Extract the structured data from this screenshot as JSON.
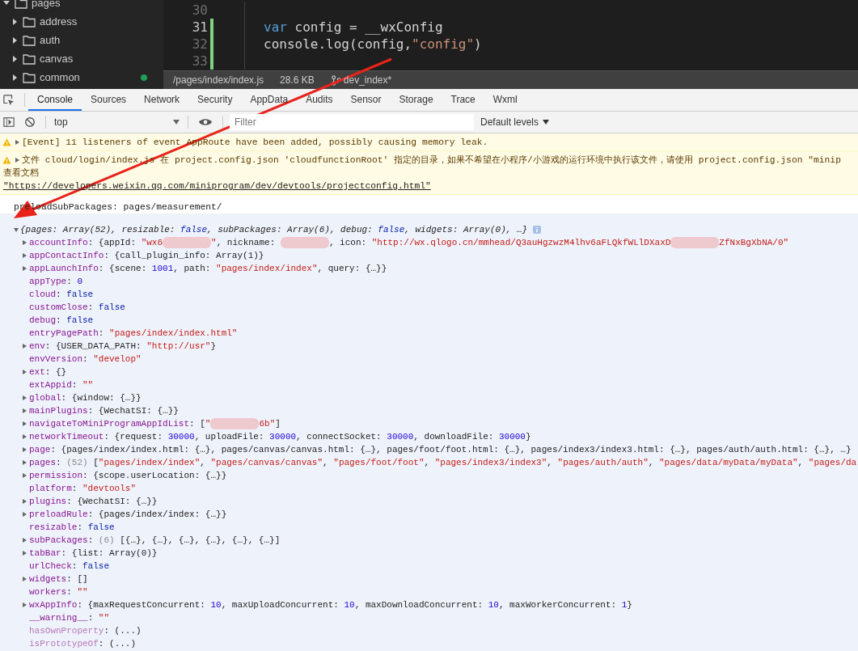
{
  "file_tree": {
    "root": {
      "label": "pages",
      "expanded": true
    },
    "items": [
      {
        "label": "address",
        "expanded": false,
        "modified": false
      },
      {
        "label": "auth",
        "expanded": false,
        "modified": false
      },
      {
        "label": "canvas",
        "expanded": false,
        "modified": false
      },
      {
        "label": "common",
        "expanded": false,
        "modified": true
      }
    ]
  },
  "editor": {
    "lines": [
      {
        "number": "30",
        "current": false,
        "changed": false
      },
      {
        "number": "31",
        "current": true,
        "changed": true,
        "code": [
          {
            "kind": "keyword",
            "text": "var"
          },
          {
            "kind": "plain",
            "text": " config = __wxConfig"
          }
        ]
      },
      {
        "number": "32",
        "current": false,
        "changed": true,
        "code": [
          {
            "kind": "plain",
            "text": "console.log(config,"
          },
          {
            "kind": "string",
            "text": "\"config\""
          },
          {
            "kind": "plain",
            "text": ")"
          }
        ]
      },
      {
        "number": "33",
        "current": false,
        "changed": true
      }
    ]
  },
  "status_bar": {
    "path": "/pages/index/index.js",
    "size": "28.6 KB",
    "branch": "dev_index*"
  },
  "tabs": [
    {
      "label": "Console",
      "selected": true
    },
    {
      "label": "Sources",
      "selected": false
    },
    {
      "label": "Network",
      "selected": false
    },
    {
      "label": "Security",
      "selected": false
    },
    {
      "label": "AppData",
      "selected": false
    },
    {
      "label": "Audits",
      "selected": false
    },
    {
      "label": "Sensor",
      "selected": false
    },
    {
      "label": "Storage",
      "selected": false
    },
    {
      "label": "Trace",
      "selected": false
    },
    {
      "label": "Wxml",
      "selected": false
    }
  ],
  "toolbar": {
    "context": "top",
    "filter": {
      "placeholder": "Filter"
    },
    "levels": "Default levels"
  },
  "messages": [
    {
      "kind": "warning",
      "expanded": false,
      "text": "[Event] 11 listeners of event AppRoute have been added, possibly causing memory leak."
    },
    {
      "kind": "warning",
      "expanded": false,
      "text": "文件 cloud/login/index.js 在 project.config.json 'cloudfunctionRoot' 指定的目录，如果不希望在小程序/小游戏的运行环境中执行该文件，请使用 project.config.json \"minip",
      "text2": "查看文档",
      "link": "\"https://developers.weixin.qq.com/miniprogram/dev/devtools/projectconfig.html\""
    },
    {
      "kind": "log",
      "text": "preloadSubPackages: pages/measurement/"
    }
  ],
  "object": {
    "expanded": true,
    "summary": [
      {
        "kind": "plain",
        "text": "{pages: Array(52), resizable: "
      },
      {
        "kind": "keyword",
        "text": "false"
      },
      {
        "kind": "plain",
        "text": ", subPackages: Array(6), debug: "
      },
      {
        "kind": "keyword",
        "text": "false"
      },
      {
        "kind": "plain",
        "text": ", widgets: Array(0), …}"
      }
    ],
    "properties": [
      {
        "key": "accountInfo",
        "expanded": false,
        "value": [
          {
            "kind": "plain",
            "text": ": {appId: "
          },
          {
            "kind": "string",
            "text": "\"wx6"
          },
          {
            "kind": "redacted"
          },
          {
            "kind": "string",
            "text": "\""
          },
          {
            "kind": "plain",
            "text": ", nickname: "
          },
          {
            "kind": "redacted"
          },
          {
            "kind": "plain",
            "text": ", icon: "
          },
          {
            "kind": "string",
            "text": "\"http://wx.qlogo.cn/mmhead/Q3auHgzwzM4lhv6aFLQkfWLlDXaxD"
          },
          {
            "kind": "redacted"
          },
          {
            "kind": "string",
            "text": "ZfNxBgXbNA/0\""
          }
        ]
      },
      {
        "key": "appContactInfo",
        "expanded": false,
        "value": [
          {
            "kind": "plain",
            "text": ": {call_plugin_info: Array(1)}"
          }
        ]
      },
      {
        "key": "appLaunchInfo",
        "expanded": false,
        "value": [
          {
            "kind": "plain",
            "text": ": {scene: "
          },
          {
            "kind": "number",
            "text": "1001"
          },
          {
            "kind": "plain",
            "text": ", path: "
          },
          {
            "kind": "string",
            "text": "\"pages/index/index\""
          },
          {
            "kind": "plain",
            "text": ", query: {…}}"
          }
        ]
      },
      {
        "key": "appType",
        "value": [
          {
            "kind": "plain",
            "text": ": "
          },
          {
            "kind": "number",
            "text": "0"
          }
        ]
      },
      {
        "key": "cloud",
        "value": [
          {
            "kind": "plain",
            "text": ": "
          },
          {
            "kind": "keyword",
            "text": "false"
          }
        ]
      },
      {
        "key": "customClose",
        "value": [
          {
            "kind": "plain",
            "text": ": "
          },
          {
            "kind": "keyword",
            "text": "false"
          }
        ]
      },
      {
        "key": "debug",
        "value": [
          {
            "kind": "plain",
            "text": ": "
          },
          {
            "kind": "keyword",
            "text": "false"
          }
        ]
      },
      {
        "key": "entryPagePath",
        "value": [
          {
            "kind": "plain",
            "text": ": "
          },
          {
            "kind": "string",
            "text": "\"pages/index/index.html\""
          }
        ]
      },
      {
        "key": "env",
        "expanded": false,
        "value": [
          {
            "kind": "plain",
            "text": ": {USER_DATA_PATH: "
          },
          {
            "kind": "string",
            "text": "\"http://usr\""
          },
          {
            "kind": "plain",
            "text": "}"
          }
        ]
      },
      {
        "key": "envVersion",
        "value": [
          {
            "kind": "plain",
            "text": ": "
          },
          {
            "kind": "string",
            "text": "\"develop\""
          }
        ]
      },
      {
        "key": "ext",
        "expanded": false,
        "value": [
          {
            "kind": "plain",
            "text": ": {}"
          }
        ]
      },
      {
        "key": "extAppid",
        "value": [
          {
            "kind": "plain",
            "text": ": "
          },
          {
            "kind": "string",
            "text": "\"\""
          }
        ]
      },
      {
        "key": "global",
        "expanded": false,
        "value": [
          {
            "kind": "plain",
            "text": ": {window: {…}}"
          }
        ]
      },
      {
        "key": "mainPlugins",
        "expanded": false,
        "value": [
          {
            "kind": "plain",
            "text": ": {WechatSI: {…}}"
          }
        ]
      },
      {
        "key": "navigateToMiniProgramAppIdList",
        "expanded": false,
        "value": [
          {
            "kind": "plain",
            "text": ": ["
          },
          {
            "kind": "string",
            "text": "\""
          },
          {
            "kind": "redacted"
          },
          {
            "kind": "string",
            "text": "6b\""
          },
          {
            "kind": "plain",
            "text": "]"
          }
        ]
      },
      {
        "key": "networkTimeout",
        "expanded": false,
        "value": [
          {
            "kind": "plain",
            "text": ": {request: "
          },
          {
            "kind": "number",
            "text": "30000"
          },
          {
            "kind": "plain",
            "text": ", uploadFile: "
          },
          {
            "kind": "number",
            "text": "30000"
          },
          {
            "kind": "plain",
            "text": ", connectSocket: "
          },
          {
            "kind": "number",
            "text": "30000"
          },
          {
            "kind": "plain",
            "text": ", downloadFile: "
          },
          {
            "kind": "number",
            "text": "30000"
          },
          {
            "kind": "plain",
            "text": "}"
          }
        ]
      },
      {
        "key": "page",
        "expanded": false,
        "value": [
          {
            "kind": "plain",
            "text": ": {pages/index/index.html: {…}, pages/canvas/canvas.html: {…}, pages/foot/foot.html: {…}, pages/index3/index3.html: {…}, pages/auth/auth.html: {…}, …}"
          }
        ]
      },
      {
        "key": "pages",
        "expanded": false,
        "value": [
          {
            "kind": "plain",
            "text": ": "
          },
          {
            "kind": "count",
            "text": "(52)"
          },
          {
            "kind": "plain",
            "text": " ["
          },
          {
            "kind": "string",
            "text": "\"pages/index/index\""
          },
          {
            "kind": "plain",
            "text": ", "
          },
          {
            "kind": "string",
            "text": "\"pages/canvas/canvas\""
          },
          {
            "kind": "plain",
            "text": ", "
          },
          {
            "kind": "string",
            "text": "\"pages/foot/foot\""
          },
          {
            "kind": "plain",
            "text": ", "
          },
          {
            "kind": "string",
            "text": "\"pages/index3/index3\""
          },
          {
            "kind": "plain",
            "text": ", "
          },
          {
            "kind": "string",
            "text": "\"pages/auth/auth\""
          },
          {
            "kind": "plain",
            "text": ", "
          },
          {
            "kind": "string",
            "text": "\"pages/data/myData/myData\""
          },
          {
            "kind": "plain",
            "text": ", "
          },
          {
            "kind": "string",
            "text": "\"pages/da"
          }
        ]
      },
      {
        "key": "permission",
        "expanded": false,
        "value": [
          {
            "kind": "plain",
            "text": ": {scope.userLocation: {…}}"
          }
        ]
      },
      {
        "key": "platform",
        "value": [
          {
            "kind": "plain",
            "text": ": "
          },
          {
            "kind": "string",
            "text": "\"devtools\""
          }
        ]
      },
      {
        "key": "plugins",
        "expanded": false,
        "value": [
          {
            "kind": "plain",
            "text": ": {WechatSI: {…}}"
          }
        ]
      },
      {
        "key": "preloadRule",
        "expanded": false,
        "value": [
          {
            "kind": "plain",
            "text": ": {pages/index/index: {…}}"
          }
        ]
      },
      {
        "key": "resizable",
        "value": [
          {
            "kind": "plain",
            "text": ": "
          },
          {
            "kind": "keyword",
            "text": "false"
          }
        ]
      },
      {
        "key": "subPackages",
        "expanded": false,
        "value": [
          {
            "kind": "plain",
            "text": ": "
          },
          {
            "kind": "count",
            "text": "(6)"
          },
          {
            "kind": "plain",
            "text": " [{…}, {…}, {…}, {…}, {…}, {…}]"
          }
        ]
      },
      {
        "key": "tabBar",
        "expanded": false,
        "value": [
          {
            "kind": "plain",
            "text": ": {list: Array(0)}"
          }
        ]
      },
      {
        "key": "urlCheck",
        "value": [
          {
            "kind": "plain",
            "text": ": "
          },
          {
            "kind": "keyword",
            "text": "false"
          }
        ]
      },
      {
        "key": "widgets",
        "expanded": false,
        "value": [
          {
            "kind": "plain",
            "text": ": []"
          }
        ]
      },
      {
        "key": "workers",
        "value": [
          {
            "kind": "plain",
            "text": ": "
          },
          {
            "kind": "string",
            "text": "\"\""
          }
        ]
      },
      {
        "key": "wxAppInfo",
        "expanded": false,
        "value": [
          {
            "kind": "plain",
            "text": ": {maxRequestConcurrent: "
          },
          {
            "kind": "number",
            "text": "10"
          },
          {
            "kind": "plain",
            "text": ", maxUploadConcurrent: "
          },
          {
            "kind": "number",
            "text": "10"
          },
          {
            "kind": "plain",
            "text": ", maxDownloadConcurrent: "
          },
          {
            "kind": "number",
            "text": "10"
          },
          {
            "kind": "plain",
            "text": ", maxWorkerConcurrent: "
          },
          {
            "kind": "number",
            "text": "1"
          },
          {
            "kind": "plain",
            "text": "}"
          }
        ]
      },
      {
        "key": "__warning__",
        "value": [
          {
            "kind": "plain",
            "text": ": "
          },
          {
            "kind": "string",
            "text": "\"\""
          }
        ]
      },
      {
        "key": "hasOwnProperty",
        "inherited": true,
        "value": [
          {
            "kind": "plain",
            "text": ": (...)"
          }
        ]
      },
      {
        "key": "isPrototypeOf",
        "inherited": true,
        "value": [
          {
            "kind": "plain",
            "text": ": (...)"
          }
        ]
      }
    ]
  }
}
